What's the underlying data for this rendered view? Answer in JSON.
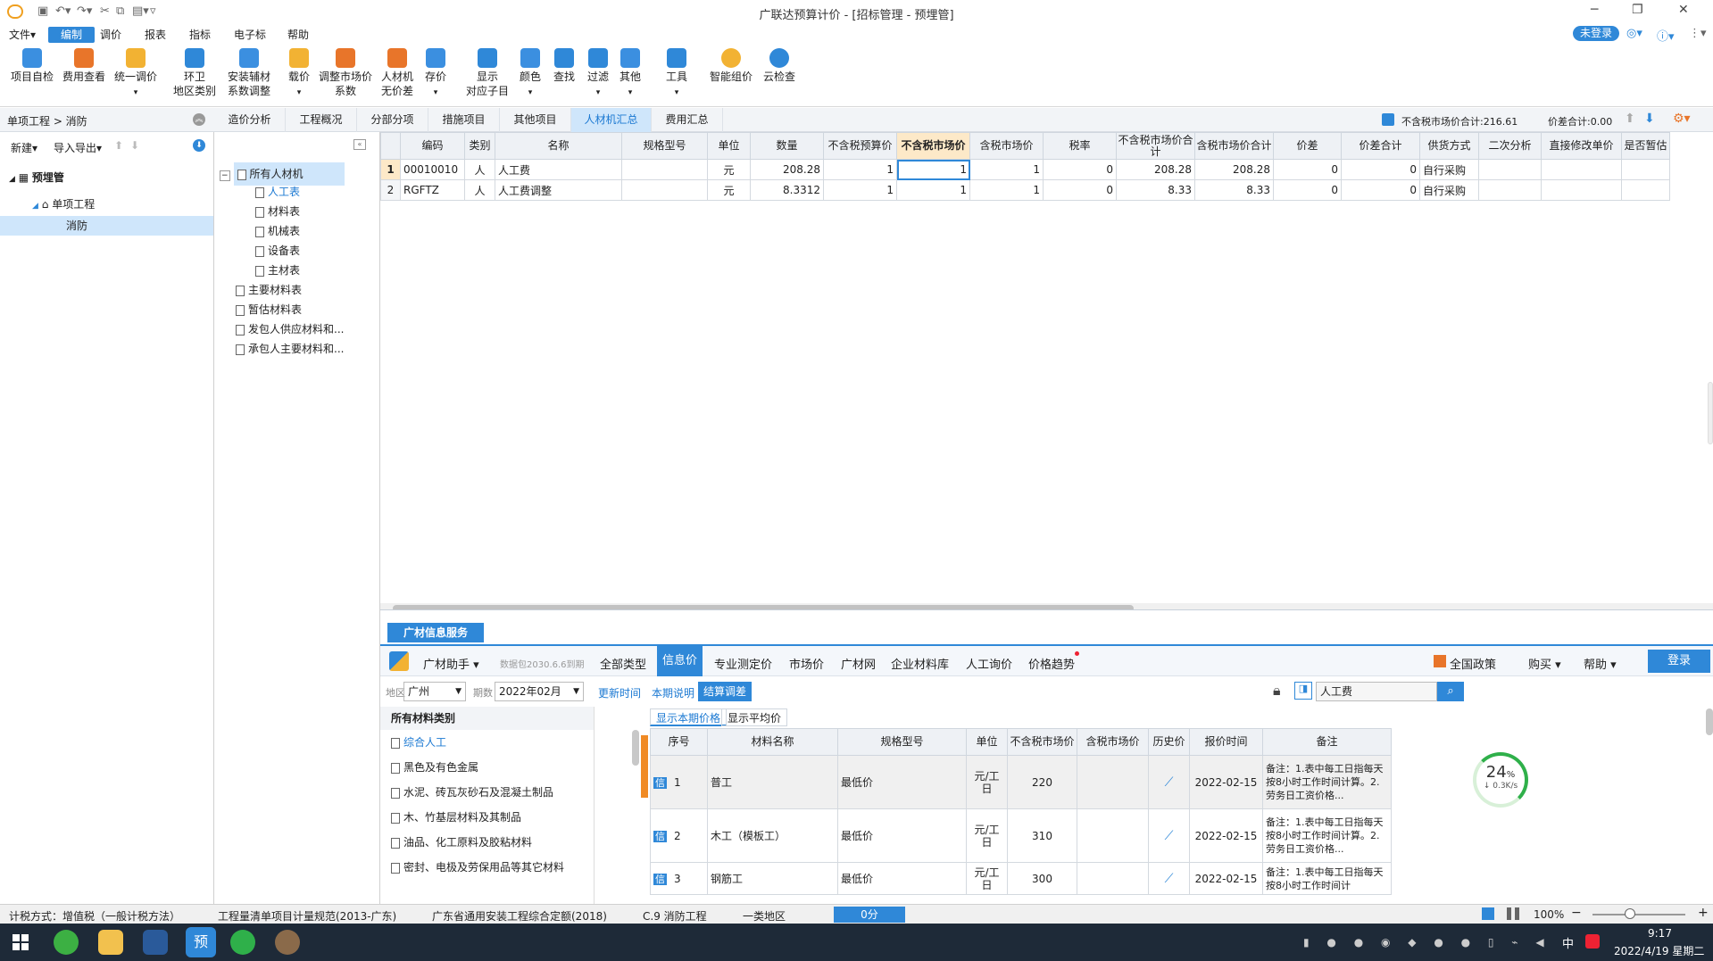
{
  "app": {
    "title": "广联达预算计价 - [招标管理 - 预埋管]"
  },
  "window": {
    "login_badge": "未登录"
  },
  "menu": [
    "文件▾",
    "编制",
    "调价",
    "报表",
    "指标",
    "电子标",
    "帮助"
  ],
  "ribbon": [
    {
      "l1": "项目自检",
      "l2": ""
    },
    {
      "l1": "费用查看",
      "l2": ""
    },
    {
      "l1": "统一调价",
      "l2": ""
    },
    {
      "l1": "环卫",
      "l2": "地区类别"
    },
    {
      "l1": "安装辅材",
      "l2": "系数调整"
    },
    {
      "l1": "载价",
      "l2": ""
    },
    {
      "l1": "调整市场价",
      "l2": "系数"
    },
    {
      "l1": "人材机",
      "l2": "无价差"
    },
    {
      "l1": "存价",
      "l2": ""
    },
    {
      "l1": "显示",
      "l2": "对应子目"
    },
    {
      "l1": "颜色",
      "l2": ""
    },
    {
      "l1": "查找",
      "l2": ""
    },
    {
      "l1": "过滤",
      "l2": ""
    },
    {
      "l1": "其他",
      "l2": ""
    },
    {
      "l1": "工具",
      "l2": ""
    },
    {
      "l1": "智能组价",
      "l2": ""
    },
    {
      "l1": "云检查",
      "l2": ""
    }
  ],
  "breadcrumb": "单项工程 > 消防",
  "tabs": [
    "造价分析",
    "工程概况",
    "分部分项",
    "措施项目",
    "其他项目",
    "人材机汇总",
    "费用汇总"
  ],
  "summary": {
    "market_total": "不含税市场价合计:216.61",
    "diff_total": "价差合计:0.00"
  },
  "left": {
    "new_btn": "新建▾",
    "io_btn": "导入导出▾",
    "tree": [
      {
        "label": "预埋管"
      },
      {
        "label": "单项工程"
      },
      {
        "label": "消防"
      }
    ]
  },
  "cat_tree": [
    "所有人材机",
    "人工表",
    "材料表",
    "机械表",
    "设备表",
    "主材表",
    "主要材料表",
    "暂估材料表",
    "发包人供应材料和...",
    "承包人主要材料和..."
  ],
  "grid": {
    "headers": [
      "编码",
      "类别",
      "名称",
      "规格型号",
      "单位",
      "数量",
      "不含税预算价",
      "不含税市场价",
      "含税市场价",
      "税率",
      "不含税市场价合计",
      "含税市场价合计",
      "价差",
      "价差合计",
      "供货方式",
      "二次分析",
      "直接修改单价",
      "是否暂估"
    ],
    "rows": [
      [
        "1",
        "00010010",
        "人",
        "人工费",
        "",
        "元",
        "208.28",
        "1",
        "1",
        "1",
        "0",
        "208.28",
        "208.28",
        "0",
        "0",
        "自行采购",
        "",
        ""
      ],
      [
        "2",
        "RGFTZ",
        "人",
        "人工费调整",
        "",
        "元",
        "8.3312",
        "1",
        "1",
        "1",
        "0",
        "8.33",
        "8.33",
        "0",
        "0",
        "自行采购",
        "",
        ""
      ]
    ]
  },
  "service": {
    "tab": "广材信息服务",
    "helper": "广材助手 ▾",
    "db_note": "数据包2030.6.6到期",
    "nav": [
      "全部类型",
      "信息价",
      "专业测定价",
      "市场价",
      "广材网",
      "企业材料库",
      "人工询价",
      "价格趋势"
    ],
    "policy": "全国政策",
    "buy": "购买 ▾",
    "help": "帮助 ▾",
    "login": "登录",
    "region_label": "地区",
    "region": "广州",
    "period_label": "期数",
    "period": "2022年02月",
    "links": [
      "更新时间",
      "本期说明",
      "结算调差"
    ],
    "search_value": "人工费",
    "cat_header": "所有材料类别",
    "cats": [
      "综合人工",
      "黑色及有色金属",
      "水泥、砖瓦灰砂石及混凝土制品",
      "木、竹基层材料及其制品",
      "油品、化工原料及胶粘材料",
      "密封、电极及劳保用品等其它材料"
    ],
    "subtabs": [
      "显示本期价格",
      "显示平均价"
    ],
    "price_headers": [
      "序号",
      "材料名称",
      "规格型号",
      "单位",
      "不含税市场价",
      "含税市场价",
      "历史价",
      "报价时间",
      "备注"
    ],
    "price_rows": [
      {
        "tag": "信",
        "no": "1",
        "name": "普工",
        "spec": "最低价",
        "unit": "元/工日",
        "price": "220",
        "tax": "",
        "date": "2022-02-15",
        "note": "备注：1.表中每工日指每天按8小时工作时间计算。2.劳务日工资价格..."
      },
      {
        "tag": "信",
        "no": "2",
        "name": "木工（模板工）",
        "spec": "最低价",
        "unit": "元/工日",
        "price": "310",
        "tax": "",
        "date": "2022-02-15",
        "note": "备注：1.表中每工日指每天按8小时工作时间计算。2.劳务日工资价格..."
      },
      {
        "tag": "信",
        "no": "3",
        "name": "钢筋工",
        "spec": "最低价",
        "unit": "元/工日",
        "price": "300",
        "tax": "",
        "date": "2022-02-15",
        "note": "备注：1.表中每工日指每天按8小时工作时间计"
      }
    ],
    "gauge": {
      "pct": "24",
      "unit": "%",
      "speed": "0.3K/s"
    }
  },
  "status": {
    "items": [
      "计税方式：增值税（一般计税方法）",
      "工程量清单项目计量规范(2013-广东)",
      "广东省通用安装工程综合定额(2018)",
      "C.9 消防工程",
      "一类地区"
    ],
    "score": "0分",
    "zoom": "100%"
  },
  "taskbar": {
    "time": "9:17",
    "date": "2022/4/19 星期二",
    "ime": "中"
  }
}
